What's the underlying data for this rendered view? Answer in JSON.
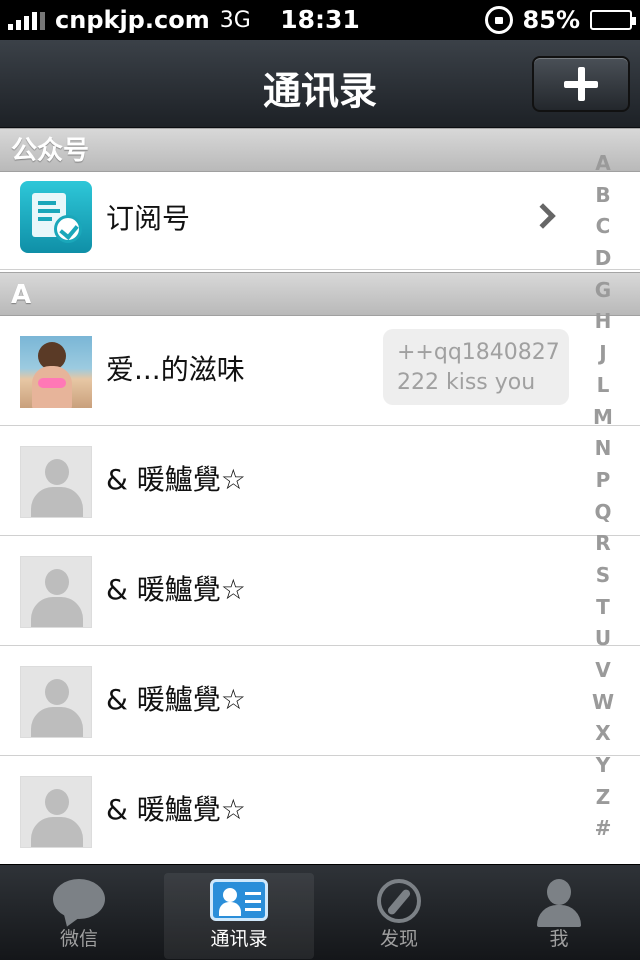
{
  "status_bar": {
    "carrier": "cnpkjp.com",
    "network": "3G",
    "time": "18:31",
    "battery": "85%",
    "battery_level": 0.85
  },
  "navbar": {
    "title": "通讯录"
  },
  "sections": {
    "public_accounts": "公众号",
    "a": "A"
  },
  "subscriptions": {
    "label": "订阅号"
  },
  "contacts": [
    {
      "name": "爱...的滋味",
      "status_line1": "++qq1840827",
      "status_line2": "222 kiss you"
    },
    {
      "name": "& 暖鱸覺☆"
    },
    {
      "name": "& 暖鱸覺☆"
    },
    {
      "name": "& 暖鱸覺☆"
    },
    {
      "name": "& 暖鱸覺☆"
    }
  ],
  "index_letters": [
    "A",
    "B",
    "C",
    "D",
    "G",
    "H",
    "J",
    "L",
    "M",
    "N",
    "P",
    "Q",
    "R",
    "S",
    "T",
    "U",
    "V",
    "W",
    "X",
    "Y",
    "Z",
    "#"
  ],
  "tabs": [
    {
      "label": "微信"
    },
    {
      "label": "通讯录"
    },
    {
      "label": "发现"
    },
    {
      "label": "我"
    }
  ],
  "colors": {
    "navbar": "#2a2f35",
    "section_header": "#c6c6c6",
    "active_tab_icon": "#2a8ed9"
  }
}
